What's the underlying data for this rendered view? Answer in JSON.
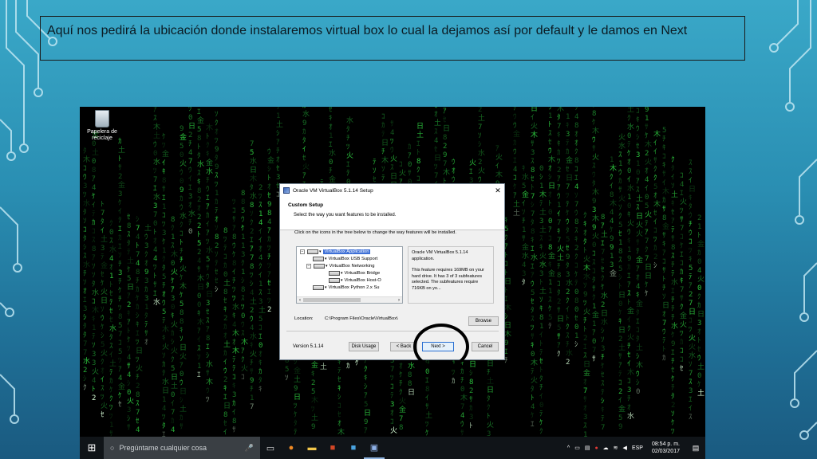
{
  "caption": "Aquí nos pedirá la ubicación donde instalaremos virtual box lo cual la dejamos así por default y le damos en Next",
  "desktop": {
    "recycle_bin_label": "Papelera de reciclaje"
  },
  "dialog": {
    "title": "Oracle VM VirtualBox 5.1.14 Setup",
    "heading": "Custom Setup",
    "subheading": "Select the way you want features to be installed.",
    "instructions": "Click on the icons in the tree below to change the way features will be installed.",
    "tree": [
      {
        "label": "VirtualBox Application",
        "selected": true
      },
      {
        "label": "VirtualBox USB Support"
      },
      {
        "label": "VirtualBox Networking"
      },
      {
        "label": "VirtualBox Bridge"
      },
      {
        "label": "VirtualBox Host-O"
      },
      {
        "label": "VirtualBox Python 2.x Su"
      }
    ],
    "info": {
      "line1": "Oracle VM VirtualBox 5.1.14 application.",
      "line2": "This feature requires 169MB on your hard drive. It has 3 of 3 subfeatures selected. The subfeatures require 716KB on yo..."
    },
    "location_label": "Location:",
    "location_value": "C:\\Program Files\\Oracle\\VirtualBox\\",
    "browse_label": "Browse",
    "version": "Version 5.1.14",
    "disk_usage_label": "Disk Usage",
    "back_label": "< Back",
    "next_label": "Next >",
    "cancel_label": "Cancel"
  },
  "taskbar": {
    "search_placeholder": "Pregúntame cualquier cosa",
    "language": "ESP",
    "time": "08:54 p. m.",
    "date": "02/03/2017"
  }
}
